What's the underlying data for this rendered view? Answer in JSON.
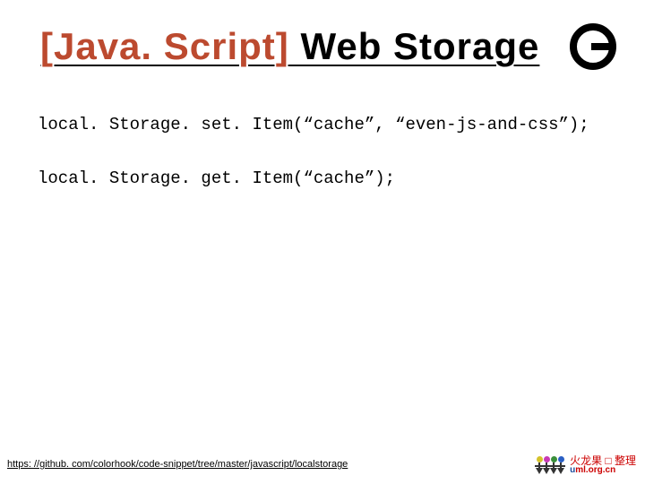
{
  "title": {
    "bracket": "[Java. Script]",
    "rest": " Web Storage"
  },
  "code": {
    "line1": "local. Storage. set. Item(“cache”, “even-js-and-css”);",
    "line2": "local. Storage. get. Item(“cache”);"
  },
  "footer": {
    "link": "https: //github. com/colorhook/code-snippet/tree/master/javascript/localstorage",
    "brand_cn": "火龙果 □ 整理",
    "brand_en_prefix": "u",
    "brand_en_rest": "ml.org.cn"
  }
}
